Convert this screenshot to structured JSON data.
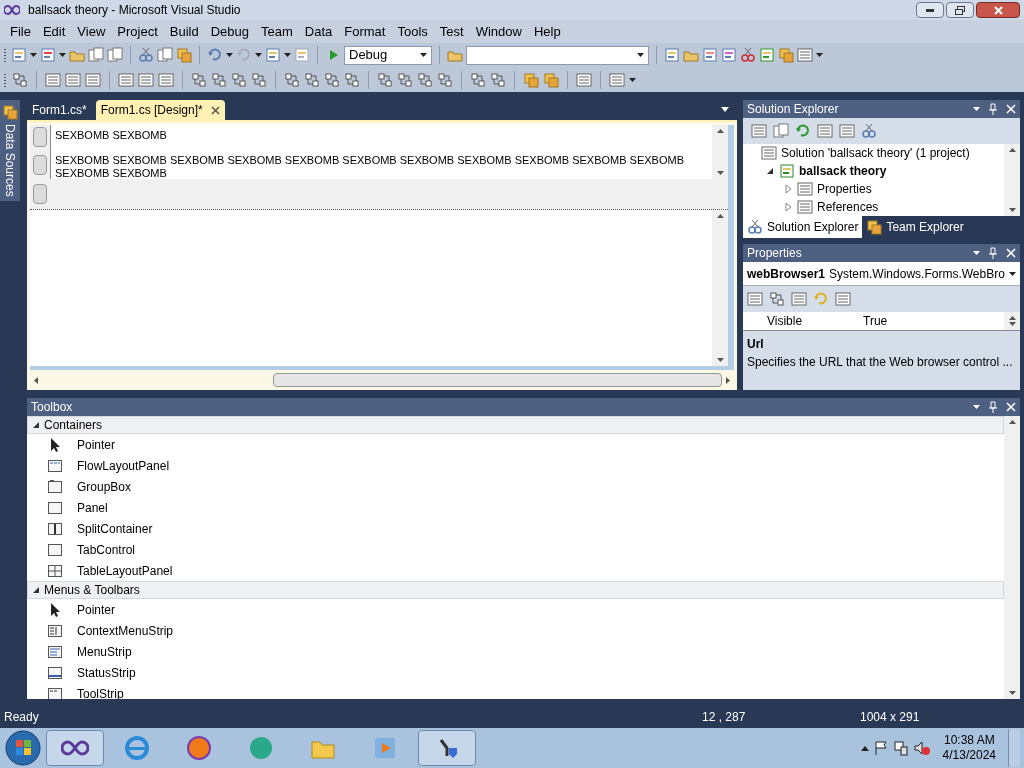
{
  "window": {
    "title": "ballsack theory - Microsoft Visual Studio"
  },
  "menu": [
    "File",
    "Edit",
    "View",
    "Project",
    "Build",
    "Debug",
    "Team",
    "Data",
    "Format",
    "Tools",
    "Test",
    "Window",
    "Help"
  ],
  "toolbar": {
    "configuration": "Debug"
  },
  "side_tab": "Data Sources",
  "document_tabs": [
    {
      "label": "Form1.cs*",
      "selected": false
    },
    {
      "label": "Form1.cs [Design]*",
      "selected": true
    }
  ],
  "designer": {
    "lines": [
      "SEXBOMB SEXBOMB",
      "SEXBOMB SEXBOMB SEXBOMB SEXBOMB SEXBOMB SEXBOMB SEXBOMB SEXBOMB SEXBOMB SEXBOMB SEXBOMB SEXBOMB SEXBOMB"
    ]
  },
  "solution_explorer": {
    "title": "Solution Explorer",
    "tree": [
      {
        "label": "Solution 'ballsack theory' (1 project)",
        "bold": false,
        "children": [
          {
            "label": "ballsack theory",
            "bold": true,
            "expanded": true,
            "children": [
              {
                "label": "Properties",
                "bold": false,
                "expanded": false
              },
              {
                "label": "References",
                "bold": false,
                "expanded": false
              }
            ]
          }
        ]
      }
    ],
    "tabs": [
      {
        "label": "Solution Explorer",
        "selected": true
      },
      {
        "label": "Team Explorer",
        "selected": false
      }
    ]
  },
  "properties": {
    "title": "Properties",
    "object_name": "webBrowser1",
    "object_type": "System.Windows.Forms.WebBro",
    "rows": [
      {
        "name": "Visible",
        "value": "True"
      }
    ],
    "description_title": "Url",
    "description": "Specifies the URL that the Web browser control ..."
  },
  "toolbox": {
    "title": "Toolbox",
    "groups": [
      {
        "name": "Containers",
        "expanded": true,
        "items": [
          "Pointer",
          "FlowLayoutPanel",
          "GroupBox",
          "Panel",
          "SplitContainer",
          "TabControl",
          "TableLayoutPanel"
        ]
      },
      {
        "name": "Menus & Toolbars",
        "expanded": true,
        "items": [
          "Pointer",
          "ContextMenuStrip",
          "MenuStrip",
          "StatusStrip",
          "ToolStrip"
        ]
      }
    ]
  },
  "status_bar": {
    "text": "Ready",
    "position": "12 , 287",
    "size": "1004 x 291"
  },
  "taskbar": {
    "apps": [
      {
        "running": true
      },
      {
        "running": false
      },
      {
        "running": false
      },
      {
        "running": false
      },
      {
        "running": false
      },
      {
        "running": false
      },
      {
        "running": true
      }
    ],
    "time": "10:38 AM",
    "date": "4/13/2024"
  }
}
